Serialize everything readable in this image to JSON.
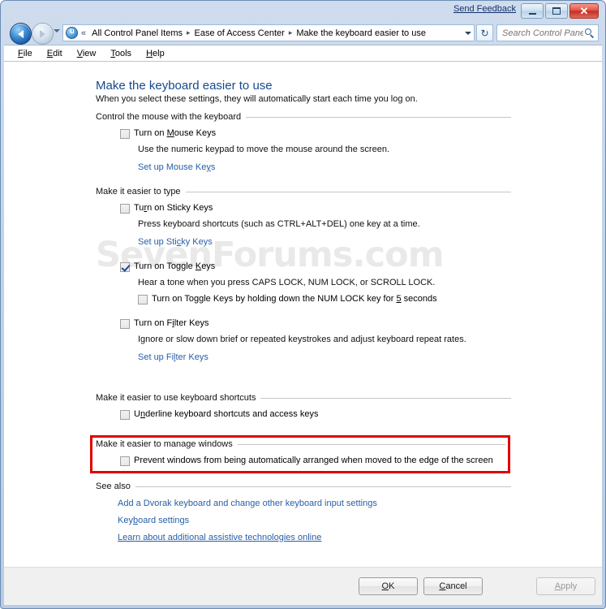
{
  "window": {
    "send_feedback": "Send Feedback",
    "minimize_label": "Minimize",
    "maximize_label": "Maximize",
    "close_label": "✕"
  },
  "nav": {
    "back_label": "Back",
    "forward_label": "Forward",
    "history_label": "Recent pages",
    "chevron": "«",
    "breadcrumbs": [
      "All Control Panel Items",
      "Ease of Access Center",
      "Make the keyboard easier to use"
    ],
    "separator": "▸",
    "refresh_label": "↻",
    "search_placeholder": "Search Control Panel"
  },
  "menu": {
    "items": [
      {
        "pre": "",
        "key": "F",
        "post": "ile"
      },
      {
        "pre": "",
        "key": "E",
        "post": "dit"
      },
      {
        "pre": "",
        "key": "V",
        "post": "iew"
      },
      {
        "pre": "",
        "key": "T",
        "post": "ools"
      },
      {
        "pre": "",
        "key": "H",
        "post": "elp"
      }
    ]
  },
  "page": {
    "watermark": "SevenForums.com",
    "title": "Make the keyboard easier to use",
    "subtitle": "When you select these settings, they will automatically start each time you log on."
  },
  "sections": {
    "mouse_keys": {
      "header": "Control the mouse with the keyboard",
      "checkbox_pre": "Turn on ",
      "checkbox_key": "M",
      "checkbox_post": "ouse Keys",
      "checked": false,
      "description": "Use the numeric keypad to move the mouse around the screen.",
      "link_pre": "Set up Mouse Ke",
      "link_key": "y",
      "link_post": "s"
    },
    "typing": {
      "header": "Make it easier to type",
      "sticky": {
        "checkbox_pre": "Tu",
        "checkbox_key": "r",
        "checkbox_post": "n on Sticky Keys",
        "checked": false,
        "description": "Press keyboard shortcuts (such as CTRL+ALT+DEL) one key at a time.",
        "link_pre": "Set up Sti",
        "link_key": "c",
        "link_post": "ky Keys"
      },
      "toggle": {
        "checkbox_pre": "Turn on Toggle ",
        "checkbox_key": "K",
        "checkbox_post": "eys",
        "checked": true,
        "description": "Hear a tone when you press CAPS LOCK, NUM LOCK, or SCROLL LOCK.",
        "sub_checkbox_pre": "Turn on Toggle Keys by holding down the NUM LOCK key for ",
        "sub_checkbox_key": "5",
        "sub_checkbox_post": " seconds",
        "sub_checked": false
      },
      "filter": {
        "checkbox_pre": "Turn on F",
        "checkbox_key": "i",
        "checkbox_post": "lter Keys",
        "checked": false,
        "description": "Ignore or slow down brief or repeated keystrokes and adjust keyboard repeat rates.",
        "link_pre": "Set up Fi",
        "link_key": "l",
        "link_post": "ter Keys"
      }
    },
    "shortcuts": {
      "header": "Make it easier to use keyboard shortcuts",
      "checkbox_pre": "U",
      "checkbox_key": "n",
      "checkbox_post": "derline keyboard shortcuts and access keys",
      "checked": false
    },
    "manage_windows": {
      "header": "Make it easier to manage windows",
      "checkbox": "Prevent windows from being automatically arranged when moved to the edge of the screen",
      "checked": false,
      "highlight_color": "#e00000"
    },
    "see_also": {
      "header": "See also",
      "links": [
        {
          "pre": "Add a Dvorak keyboard and chan",
          "key": "g",
          "post": "e other keyboard input settings",
          "external": false
        },
        {
          "pre": "Key",
          "key": "b",
          "post": "oard settings",
          "external": false
        },
        {
          "pre": "Learn about additional assistive technologies online",
          "key": "",
          "post": "",
          "external": true
        }
      ]
    }
  },
  "footer": {
    "ok_pre": "",
    "ok_key": "O",
    "ok_post": "K",
    "cancel_pre": "",
    "cancel_key": "C",
    "cancel_post": "ancel",
    "apply_pre": "",
    "apply_key": "A",
    "apply_post": "pply",
    "apply_enabled": false
  },
  "colors": {
    "title_blue": "#17498c",
    "link_blue": "#265fa8",
    "highlight_red": "#e00000",
    "watermark_gray": "#e9e9e9"
  }
}
